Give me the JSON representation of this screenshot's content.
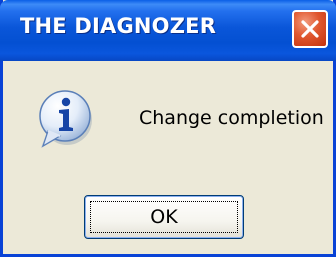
{
  "dialog": {
    "title": "THE DIAGNOZER",
    "message": "Change completion",
    "icon": "info-icon",
    "ok_label": "OK",
    "close_icon": "close-icon"
  },
  "colors": {
    "titlebar": "#0450d2",
    "frame": "#0842d6",
    "dialog_background": "#ece9d8",
    "close_button": "#e0572e",
    "title_text": "#ffffff"
  }
}
